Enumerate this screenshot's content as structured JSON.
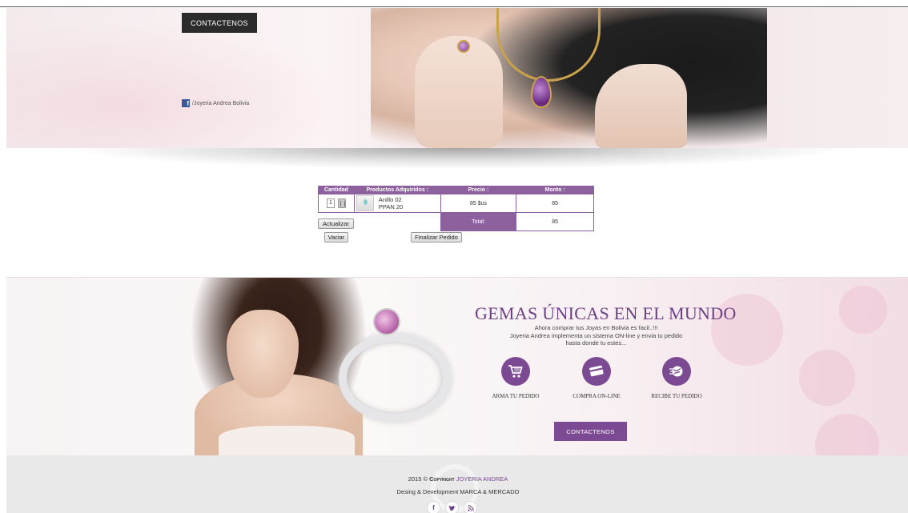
{
  "hero": {
    "contact_button": "CONTACTENOS",
    "facebook_text": "/Joyeria Andrea Bolivia"
  },
  "cart": {
    "headers": [
      "Cantidad",
      "Productos Adquiridos :",
      "Precio :",
      "Monto :"
    ],
    "row": {
      "quantity": "1",
      "product_name": "Anillo 02",
      "product_code": "PPAN 20",
      "price": "85 $us",
      "amount": "85"
    },
    "total_label": "Total:",
    "total_value": "85",
    "update_button": "Actualizar",
    "empty_button": "Vaciar",
    "finish_button": "Finalizar Pedido"
  },
  "promo": {
    "title": "GEMAS ÚNICAS EN EL MUNDO",
    "text_line1": "Ahora comprar tus Joyas en Bolivia es facil..!!!",
    "text_line2": "Joyeria Andrea implementa un sistema ON-line y envia tu pedido",
    "text_line3": "hasta donde tu estes...",
    "features": [
      {
        "label": "ARMA TU PEDIDO",
        "icon": "cart-icon"
      },
      {
        "label": "COMPRA ON-LINE",
        "icon": "credit-card-icon"
      },
      {
        "label": "RECIBE TU PEDIDO",
        "icon": "delivery-icon"
      }
    ],
    "contact_button": "CONTACTENOS"
  },
  "footer": {
    "year": "2015 ©",
    "copyright_word": "Copyright",
    "brand": "JOYERIA ANDREA",
    "dev_line": "Desing & Development MARCA & MERCADO",
    "socials": [
      {
        "icon": "facebook-icon",
        "glyph": "f"
      },
      {
        "icon": "twitter-icon",
        "glyph": "t"
      },
      {
        "icon": "rss-icon",
        "glyph": "ʃ"
      }
    ]
  },
  "colors": {
    "accent_purple": "#7c4a92",
    "table_header": "#8c619e",
    "dark_button": "#2b2b2b",
    "footer_bg": "#e9e9e9"
  }
}
